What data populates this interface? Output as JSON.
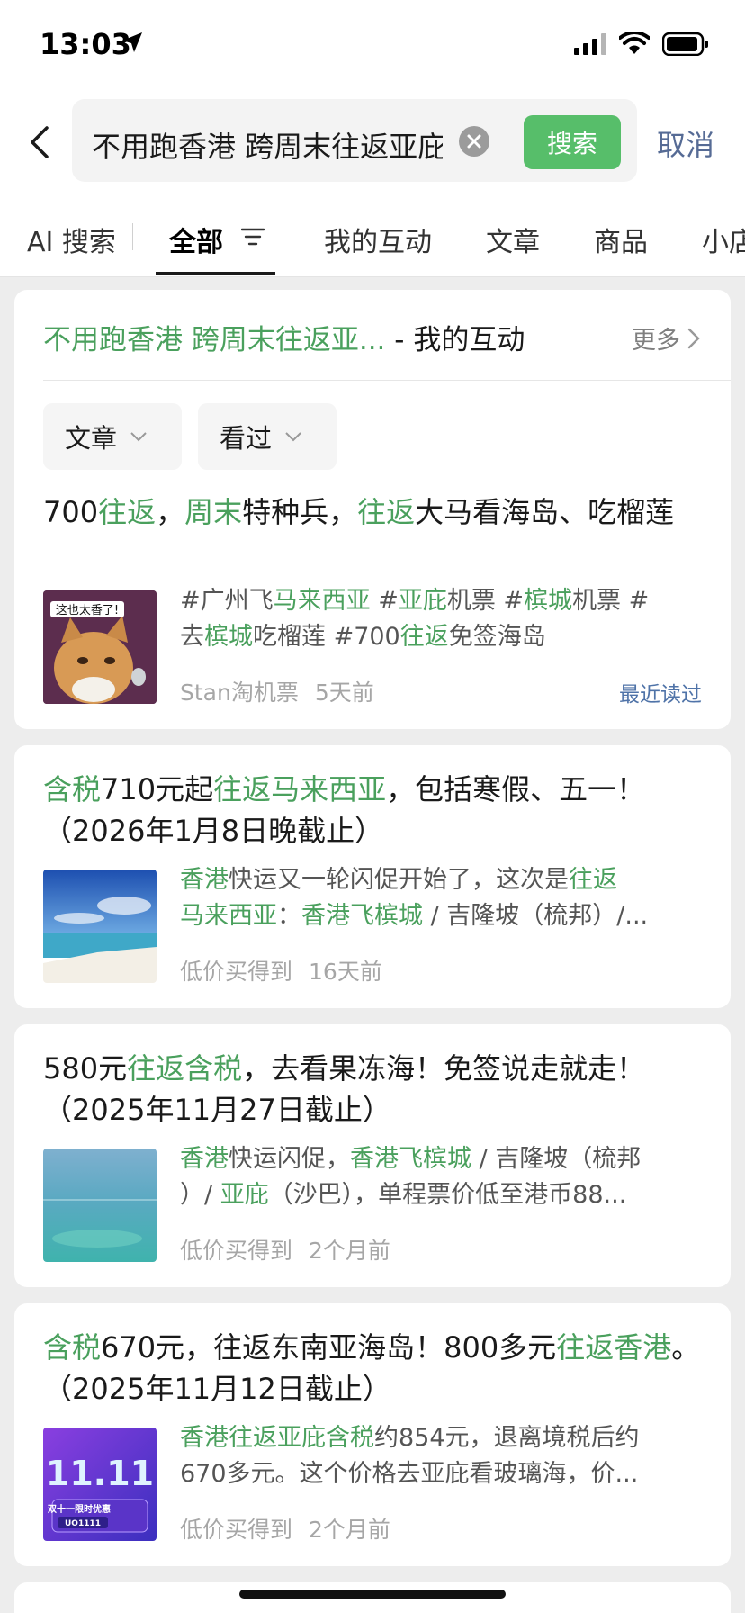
{
  "status_bar": {
    "time": "13:03"
  },
  "header": {
    "search_query": "不用跑香港 跨周末往返亚庇",
    "search_button": "搜索",
    "cancel": "取消"
  },
  "tabs": [
    {
      "label": "AI 搜索"
    },
    {
      "label": "全部"
    },
    {
      "label": "我的互动"
    },
    {
      "label": "文章"
    },
    {
      "label": "商品"
    },
    {
      "label": "小店"
    }
  ],
  "interaction_card": {
    "title_highlight": "不用跑香港 跨周末往返亚...",
    "title_suffix": " - 我的互动",
    "more": "更多",
    "filters": [
      "文章",
      "看过"
    ],
    "article": {
      "title_parts": [
        "700",
        "往返",
        "，",
        "周末",
        "特种兵，",
        "往返",
        "大马看海岛、吃榴莲"
      ],
      "desc_line1": [
        "#广州飞",
        "马来西亚",
        " #",
        "亚庇",
        "机票 #",
        "槟城",
        "机票 #"
      ],
      "desc_line2": [
        "去",
        "槟城",
        "吃榴莲 #700",
        "往返",
        "免签海岛"
      ],
      "thumb_caption": "这也太香了!",
      "source": "Stan淘机票",
      "time": "5天前",
      "badge": "最近读过"
    }
  },
  "articles": [
    {
      "title_parts": [
        "含税",
        "710元起",
        "往返马来西亚",
        "，包括寒假、五一！（2026年1月8日晚截止）"
      ],
      "desc_line1": [
        "香港",
        "快运又一轮闪促开始了，这次是",
        "往返"
      ],
      "desc_line2": [
        "马来西亚",
        "：",
        "香港飞槟城",
        " / 吉隆坡（梳邦）/..."
      ],
      "source": "低价买得到",
      "time": "16天前"
    },
    {
      "title_parts": [
        "580元",
        "往返含税",
        "，去看果冻海！免签说走就走！（2025年11月27日截止）"
      ],
      "desc_line1": [
        "香港",
        "快运闪促，",
        "香港飞槟城",
        " / 吉隆坡（梳邦"
      ],
      "desc_line2": [
        "）/ ",
        "亚庇",
        "（沙巴），单程票价低至港币88..."
      ],
      "source": "低价买得到",
      "time": "2个月前"
    },
    {
      "title_parts": [
        "含税",
        "670元，往返东南亚海岛！800多元",
        "往返香港",
        "。（2025年11月12日截止）"
      ],
      "desc_line1": [
        "香港往返亚庇含税",
        "约854元，退离境税后约"
      ],
      "desc_line2": [
        "670多元。这个价格去亚庇看玻璃海，价..."
      ],
      "thumb_caption": {
        "big": "11.11",
        "line1": "双十一限时优惠",
        "code": "UO1111"
      },
      "source": "低价买得到",
      "time": "2个月前"
    }
  ]
}
